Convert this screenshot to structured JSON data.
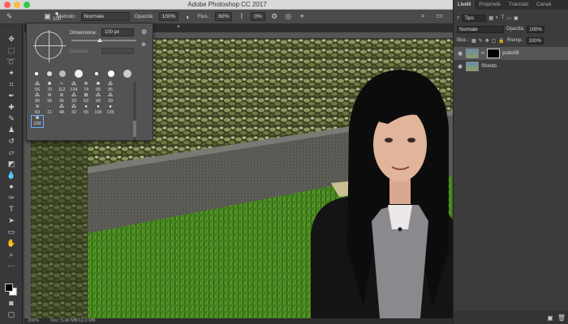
{
  "window": {
    "title": "Adobe Photoshop CC 2017"
  },
  "options_bar": {
    "brush_size": "100",
    "mode_label": "Metodo:",
    "mode_value": "Normale",
    "opacity_label": "Opacità:",
    "opacity_value": "100%",
    "flow_label": "Flus.:",
    "flow_value": "60%",
    "extra_value": "0%"
  },
  "brush_popup": {
    "size_label": "Dimensione:",
    "size_value": "100 px",
    "hardness_label": "Durezza:",
    "presets": [
      {
        "num": "55",
        "glyph": "⁂"
      },
      {
        "num": "70",
        "glyph": "✱"
      },
      {
        "num": "112",
        "glyph": "≈"
      },
      {
        "num": "134",
        "glyph": "⁂"
      },
      {
        "num": "74",
        "glyph": "✲"
      },
      {
        "num": "95",
        "glyph": "✱"
      },
      {
        "num": "95",
        "glyph": "⁂"
      },
      {
        "num": "90",
        "glyph": "⁂"
      },
      {
        "num": "36",
        "glyph": "≋"
      },
      {
        "num": "36",
        "glyph": "≋"
      },
      {
        "num": "33",
        "glyph": "⁂"
      },
      {
        "num": "63",
        "glyph": "✿"
      },
      {
        "num": "66",
        "glyph": "⁂"
      },
      {
        "num": "39",
        "glyph": "⁂"
      },
      {
        "num": "63",
        "glyph": "≋"
      },
      {
        "num": "11",
        "glyph": "·"
      },
      {
        "num": "48",
        "glyph": "⁂"
      },
      {
        "num": "32",
        "glyph": "⁂"
      },
      {
        "num": "55",
        "glyph": "●"
      },
      {
        "num": "100",
        "glyph": "●"
      },
      {
        "num": "135",
        "glyph": "●"
      },
      {
        "num": "100",
        "glyph": "❀"
      }
    ]
  },
  "layers_panel": {
    "tabs": [
      "Livelli",
      "Proprietà",
      "Tracciati",
      "Canali"
    ],
    "filter_value": "Tipo",
    "blend_value": "Normale",
    "opacity_label": "Opacità:",
    "opacity_value": "100%",
    "lock_label": "Bloc.:",
    "fill_label": "Riemp.:",
    "fill_value": "100%",
    "layers": [
      {
        "name": "prato08"
      },
      {
        "name": "Sfondo"
      }
    ]
  },
  "status_bar": {
    "zoom": "200%",
    "doc": "Doc: 5,49 MB/12,0 MB"
  }
}
